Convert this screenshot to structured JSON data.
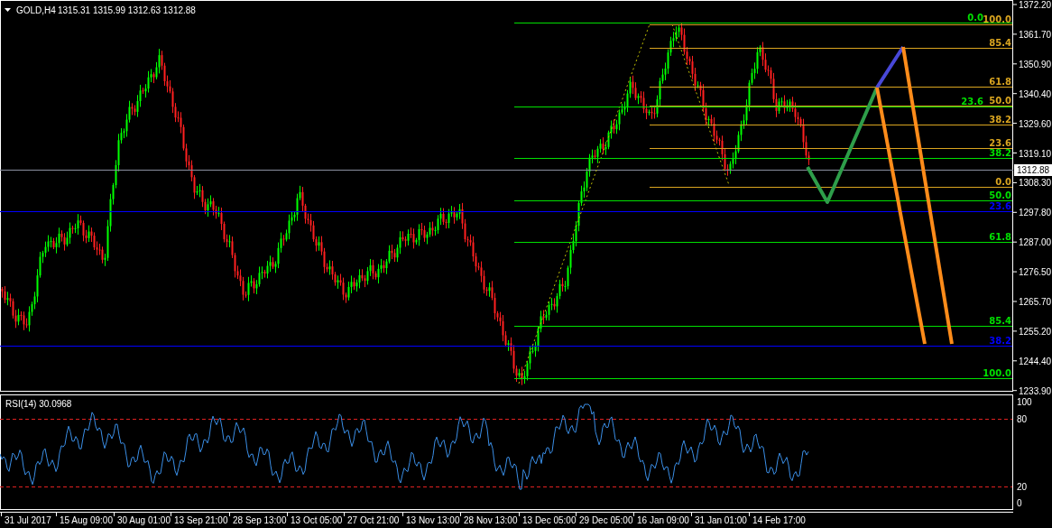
{
  "header": {
    "symbol": "GOLD,H4",
    "quote": "1315.31 1315.99 1312.63 1312.88"
  },
  "price_axis": [
    "1372.20",
    "1361.70",
    "1350.90",
    "1340.40",
    "1329.60",
    "1319.10",
    "1308.30",
    "1297.80",
    "1287.00",
    "1276.50",
    "1265.70",
    "1255.20",
    "1244.40",
    "1233.90"
  ],
  "current_price": "1312.88",
  "fib_levels": [
    {
      "label": "0.0",
      "color": "#00e000"
    },
    {
      "label": "100.0",
      "color": "#daa520"
    },
    {
      "label": "85.4",
      "color": "#daa520"
    },
    {
      "label": "61.8",
      "color": "#daa520"
    },
    {
      "label": "23.6",
      "color": "#00e000"
    },
    {
      "label": "50.0",
      "color": "#daa520"
    },
    {
      "label": "38.2",
      "color": "#daa520"
    },
    {
      "label": "23.6",
      "color": "#daa520"
    },
    {
      "label": "38.2",
      "color": "#00e000"
    },
    {
      "label": "0.0",
      "color": "#daa520"
    },
    {
      "label": "50.0",
      "color": "#00e000"
    },
    {
      "label": "23.6",
      "color": "#0000ff"
    },
    {
      "label": "61.8",
      "color": "#00e000"
    },
    {
      "label": "85.4",
      "color": "#00e000"
    },
    {
      "label": "38.2",
      "color": "#0000ff"
    },
    {
      "label": "100.0",
      "color": "#00e000"
    }
  ],
  "indicator": {
    "title": "RSI(14) 30.0968",
    "axis": [
      "100",
      "80",
      "20",
      "0"
    ]
  },
  "time_axis": [
    "31 Jul 2017",
    "15 Aug 09:00",
    "30 Aug 01:00",
    "13 Sep 21:00",
    "28 Sep 13:00",
    "13 Oct 05:00",
    "27 Oct 21:00",
    "13 Nov 13:00",
    "28 Nov 13:00",
    "13 Dec 05:00",
    "29 Dec 05:00",
    "16 Jan 09:00",
    "31 Jan 01:00",
    "14 Feb 17:00"
  ]
}
